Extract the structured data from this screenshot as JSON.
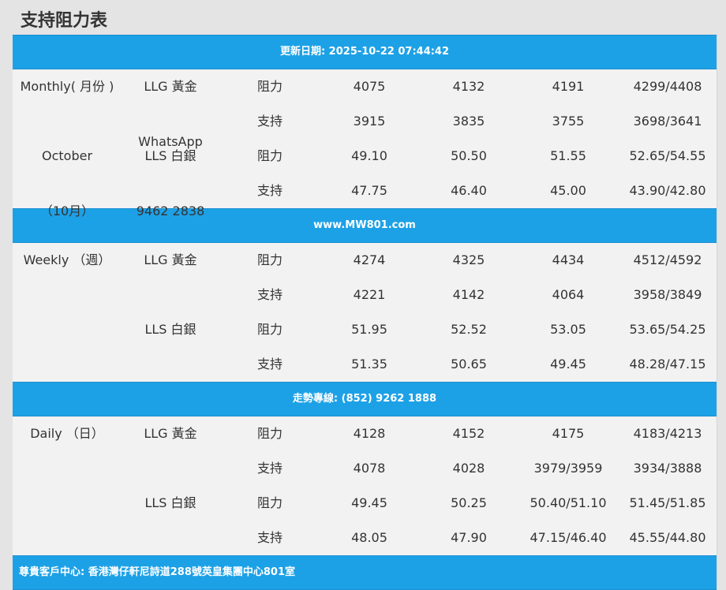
{
  "page": {
    "title": "支持阻力表"
  },
  "banners": {
    "update": "更新日期: 2025-10-22 07:44:42",
    "website": "www.MW801.com",
    "hotline": "走勢專線: (852) 9262 1888",
    "address": "尊貴客戶中心: 香港灣仔軒尼詩道288號英皇集團中心801室"
  },
  "monthly": {
    "period": "Monthly( 月份 )",
    "contact": "WhatsApp",
    "month": "October",
    "month_cn": "（10月）",
    "phone": "9462 2838",
    "rows": [
      {
        "metal": "LLG 黃金",
        "type": "阻力",
        "v": [
          "4075",
          "4132",
          "4191",
          "4299/4408"
        ]
      },
      {
        "metal": "",
        "type": "支持",
        "v": [
          "3915",
          "3835",
          "3755",
          "3698/3641"
        ]
      },
      {
        "metal": "LLS 白銀",
        "type": "阻力",
        "v": [
          "49.10",
          "50.50",
          "51.55",
          "52.65/54.55"
        ]
      },
      {
        "metal": "",
        "type": "支持",
        "v": [
          "47.75",
          "46.40",
          "45.00",
          "43.90/42.80"
        ]
      }
    ]
  },
  "weekly": {
    "period": "Weekly （週）",
    "rows": [
      {
        "metal": "LLG 黃金",
        "type": "阻力",
        "v": [
          "4274",
          "4325",
          "4434",
          "4512/4592"
        ]
      },
      {
        "metal": "",
        "type": "支持",
        "v": [
          "4221",
          "4142",
          "4064",
          "3958/3849"
        ]
      },
      {
        "metal": "LLS 白銀",
        "type": "阻力",
        "v": [
          "51.95",
          "52.52",
          "53.05",
          "53.65/54.25"
        ]
      },
      {
        "metal": "",
        "type": "支持",
        "v": [
          "51.35",
          "50.65",
          "49.45",
          "48.28/47.15"
        ]
      }
    ]
  },
  "daily": {
    "period": "Daily （日）",
    "rows": [
      {
        "metal": "LLG 黃金",
        "type": "阻力",
        "v": [
          "4128",
          "4152",
          "4175",
          "4183/4213"
        ]
      },
      {
        "metal": "",
        "type": "支持",
        "v": [
          "4078",
          "4028",
          "3979/3959",
          "3934/3888"
        ]
      },
      {
        "metal": "LLS 白銀",
        "type": "阻力",
        "v": [
          "49.45",
          "50.25",
          "50.40/51.10",
          "51.45/51.85"
        ]
      },
      {
        "metal": "",
        "type": "支持",
        "v": [
          "48.05",
          "47.90",
          "47.15/46.40",
          "45.55/44.80"
        ]
      }
    ]
  },
  "colors": {
    "banner": "#1da1e6",
    "row_bg": "#f2f2f2",
    "page_bg": "#e4e4e4",
    "text": "#333333"
  }
}
